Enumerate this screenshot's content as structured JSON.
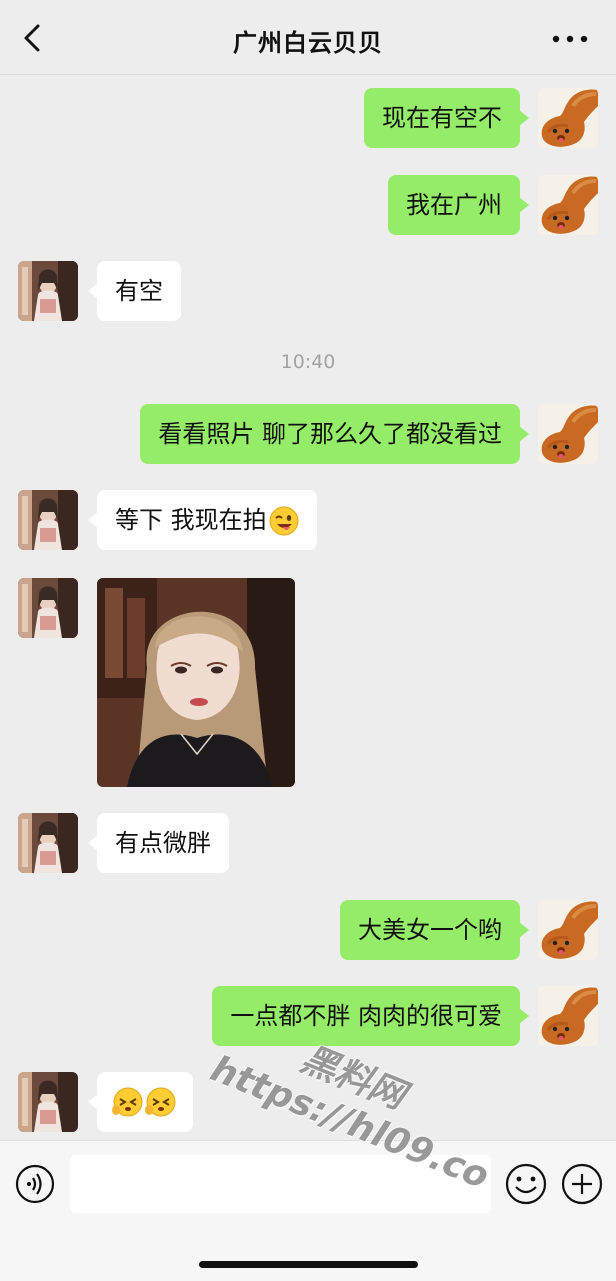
{
  "header": {
    "title": "广州白云贝贝"
  },
  "messages": {
    "m1": "现在有空不",
    "m2": "我在广州",
    "m3": "有空",
    "timestamp": "10:40",
    "m4": "看看照片 聊了那么久了都没看过",
    "m5": "等下 我现在拍",
    "m7": "有点微胖",
    "m8": "大美女一个哟",
    "m9": "一点都不胖 肉肉的很可爱"
  },
  "icons": {
    "back": "chevron-left-icon",
    "more": "more-dots-icon",
    "voice": "voice-icon",
    "emoji": "emoji-icon",
    "plus": "plus-icon",
    "wink_emoji": "winking-face-icon",
    "reaction_emoji": "squinting-face-icon"
  },
  "input": {
    "value": ""
  },
  "watermark": {
    "line1": "黑料网",
    "line2": "https://hl09.co"
  },
  "colors": {
    "background": "#ededed",
    "my_bubble": "#95ec69",
    "her_bubble": "#ffffff",
    "timestamp": "#a3a3a3"
  }
}
